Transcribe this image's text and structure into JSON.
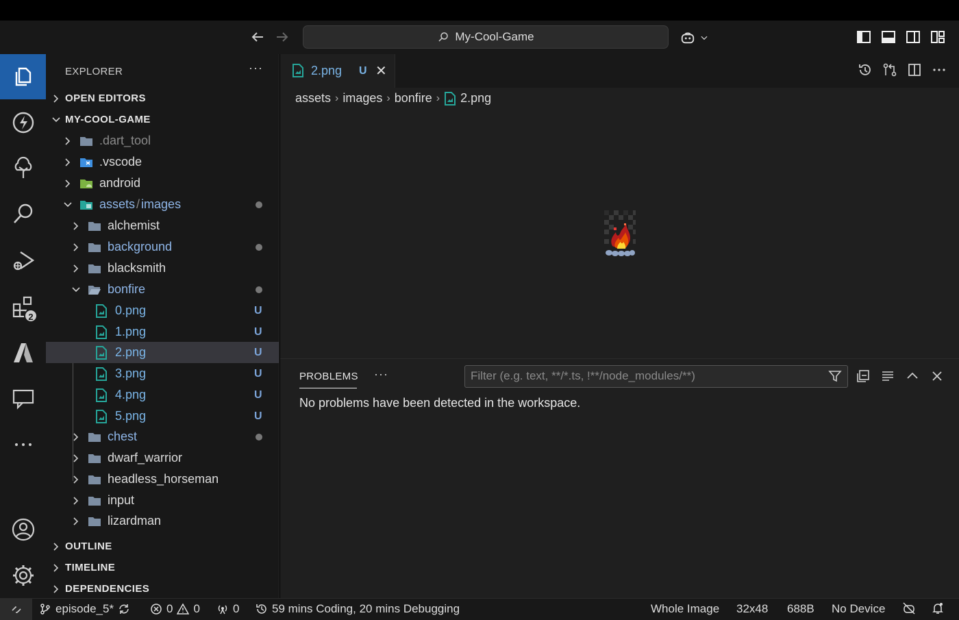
{
  "titlebar": {
    "search_text": "My-Cool-Game"
  },
  "activity": {
    "extensions_badge": "2"
  },
  "explorer": {
    "header": "EXPLORER",
    "more": "···",
    "sections": {
      "open_editors": "OPEN EDITORS",
      "project": "MY-COOL-GAME",
      "outline": "OUTLINE",
      "timeline": "TIMELINE",
      "dependencies": "DEPENDENCIES"
    },
    "tree": {
      "dart_tool": ".dart_tool",
      "vscode": ".vscode",
      "android": "android",
      "assets": "assets",
      "slash": "/",
      "images": "images",
      "alchemist": "alchemist",
      "background": "background",
      "blacksmith": "blacksmith",
      "bonfire": "bonfire",
      "files": [
        {
          "name": "0.png",
          "status": "U"
        },
        {
          "name": "1.png",
          "status": "U"
        },
        {
          "name": "2.png",
          "status": "U"
        },
        {
          "name": "3.png",
          "status": "U"
        },
        {
          "name": "4.png",
          "status": "U"
        },
        {
          "name": "5.png",
          "status": "U"
        }
      ],
      "chest": "chest",
      "dwarf_warrior": "dwarf_warrior",
      "headless_horseman": "headless_horseman",
      "input": "input",
      "lizardman": "lizardman"
    }
  },
  "editor": {
    "tab_name": "2.png",
    "tab_status": "U",
    "tab_close": "✕",
    "breadcrumb": [
      "assets",
      "images",
      "bonfire",
      "2.png"
    ],
    "breadcrumb_sep": "›"
  },
  "panel": {
    "tab": "PROBLEMS",
    "more": "···",
    "filter_placeholder": "Filter (e.g. text, **/*.ts, !**/node_modules/**)",
    "message": "No problems have been detected in the workspace."
  },
  "status": {
    "branch": "episode_5*",
    "errors": "0",
    "warnings": "0",
    "ports": "0",
    "time_tracking": "59 mins Coding, 20 mins Debugging",
    "image_mode": "Whole Image",
    "dimensions": "32x48",
    "size": "688B",
    "device": "No Device"
  },
  "colors": {
    "accent_active": "#1f5fa8",
    "untracked": "#7ab4e6",
    "modified_folder": "#8fb6e8"
  }
}
